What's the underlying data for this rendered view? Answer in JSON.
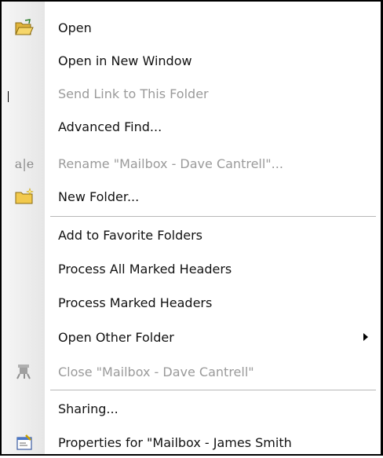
{
  "menu": {
    "items": [
      {
        "label": "Open",
        "enabled": true,
        "icon": "open-folder-icon"
      },
      {
        "label": "Open in New Window",
        "enabled": true
      },
      {
        "label": "Send Link to This Folder",
        "enabled": false
      },
      {
        "label": "Advanced Find...",
        "enabled": true
      },
      {
        "label": "Rename \"Mailbox - Dave Cantrell\"...",
        "enabled": false,
        "icon": "rename-icon",
        "icon_text": "a|e"
      },
      {
        "label": "New Folder...",
        "enabled": true,
        "icon": "new-folder-icon"
      },
      {
        "label": "Add to Favorite Folders",
        "enabled": true
      },
      {
        "label": "Process All Marked Headers",
        "enabled": true
      },
      {
        "label": "Process Marked Headers",
        "enabled": true
      },
      {
        "label": "Open Other Folder",
        "enabled": true,
        "has_submenu": true
      },
      {
        "label": "Close \"Mailbox - Dave Cantrell\"",
        "enabled": false,
        "icon": "close-mailbox-icon"
      },
      {
        "label": "Sharing...",
        "enabled": true
      },
      {
        "label": "Properties for \"Mailbox -  James Smith",
        "enabled": true,
        "icon": "properties-icon"
      }
    ]
  },
  "colors": {
    "border": "#000000",
    "text": "#111111",
    "disabled_text": "#9a9a9a",
    "separator": "#b8b8b8",
    "folder_yellow": "#f2c94c"
  }
}
